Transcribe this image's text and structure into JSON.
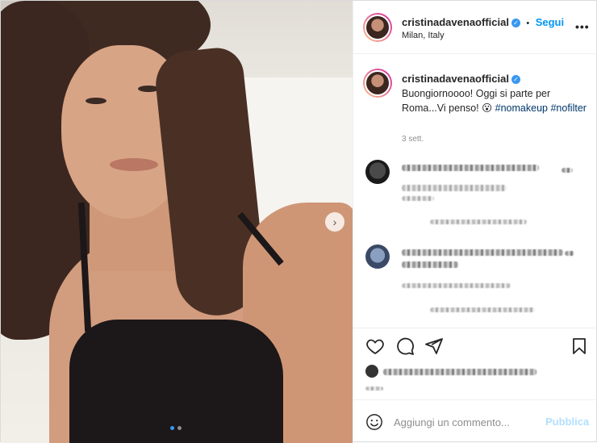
{
  "post": {
    "username": "cristinadavenaofficial",
    "follow_separator": "•",
    "follow_label": "Segui",
    "location": "Milan, Italy",
    "more_label": "•••",
    "next_label": "›",
    "caption": {
      "username": "cristinadavenaofficial",
      "text": "Buongiornoooo! Oggi si parte per Roma...Vi penso! 😮",
      "tags": [
        "#nomakeup",
        "#nofilter"
      ]
    },
    "time_ago": "3 sett.",
    "verified_mark": "✓",
    "carousel": {
      "count": 2,
      "active": 0
    }
  },
  "comments_section": {
    "add_comment_placeholder": "Aggiungi un commento...",
    "publish_label": "Pubblica"
  },
  "icons": [
    "heart-icon",
    "comment-icon",
    "share-icon",
    "bookmark-icon",
    "emoji-icon",
    "chevron-right-icon",
    "more-icon",
    "verified-icon"
  ],
  "colors": {
    "accent": "#0095f6",
    "publish_disabled": "#b2dffc",
    "hashtag": "#00376b"
  }
}
